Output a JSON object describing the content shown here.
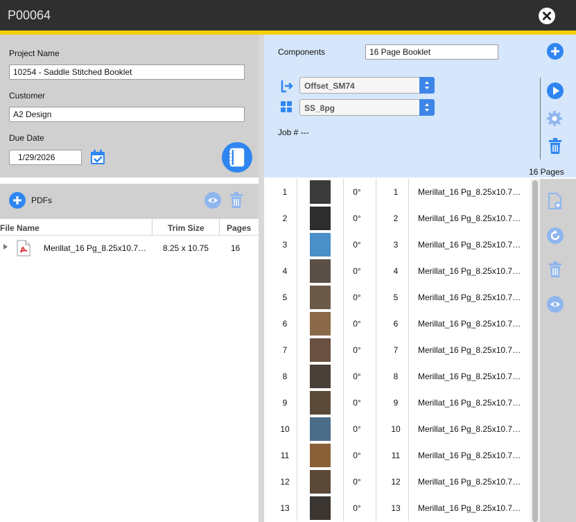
{
  "window": {
    "title": "P00064"
  },
  "project": {
    "project_name_label": "Project Name",
    "project_name": "10254 - Saddle Stitched Booklet",
    "customer_label": "Customer",
    "customer": "A2 Design",
    "due_date_label": "Due Date",
    "due_date": "1/29/2026"
  },
  "pdfs": {
    "title": "PDFs",
    "columns": [
      "File Name",
      "Trim Size",
      "Pages"
    ],
    "rows": [
      {
        "file_name": "Merillat_16 Pg_8.25x10.7…",
        "trim_size": "8.25 x 10.75",
        "pages": "16"
      }
    ]
  },
  "components": {
    "label": "Components",
    "value": "16 Page Booklet",
    "press": "Offset_SM74",
    "template": "SS_8pg",
    "job_label": "Job # ---",
    "pages_count": "16 Pages"
  },
  "page_list": {
    "rows": [
      {
        "num": "1",
        "rotation": "0°",
        "page": "1",
        "file": "Merillat_16 Pg_8.25x10.7…"
      },
      {
        "num": "2",
        "rotation": "0°",
        "page": "2",
        "file": "Merillat_16 Pg_8.25x10.7…"
      },
      {
        "num": "3",
        "rotation": "0°",
        "page": "3",
        "file": "Merillat_16 Pg_8.25x10.7…"
      },
      {
        "num": "4",
        "rotation": "0°",
        "page": "4",
        "file": "Merillat_16 Pg_8.25x10.7…"
      },
      {
        "num": "5",
        "rotation": "0°",
        "page": "5",
        "file": "Merillat_16 Pg_8.25x10.7…"
      },
      {
        "num": "6",
        "rotation": "0°",
        "page": "6",
        "file": "Merillat_16 Pg_8.25x10.7…"
      },
      {
        "num": "7",
        "rotation": "0°",
        "page": "7",
        "file": "Merillat_16 Pg_8.25x10.7…"
      },
      {
        "num": "8",
        "rotation": "0°",
        "page": "8",
        "file": "Merillat_16 Pg_8.25x10.7…"
      },
      {
        "num": "9",
        "rotation": "0°",
        "page": "9",
        "file": "Merillat_16 Pg_8.25x10.7…"
      },
      {
        "num": "10",
        "rotation": "0°",
        "page": "10",
        "file": "Merillat_16 Pg_8.25x10.7…"
      },
      {
        "num": "11",
        "rotation": "0°",
        "page": "11",
        "file": "Merillat_16 Pg_8.25x10.7…"
      },
      {
        "num": "12",
        "rotation": "0°",
        "page": "12",
        "file": "Merillat_16 Pg_8.25x10.7…"
      },
      {
        "num": "13",
        "rotation": "0°",
        "page": "13",
        "file": "Merillat_16 Pg_8.25x10.7…"
      }
    ]
  },
  "colors": {
    "accent": "#2f86f0",
    "accent_light": "#8fb6ee",
    "header": "#2f2f2f",
    "stripe": "#f4d000",
    "panel": "#d0d0d0",
    "panel_blue": "#d6e6fb"
  },
  "icons": [
    "close-icon",
    "calendar-icon",
    "booklet-icon",
    "plus-circle-icon",
    "eye-icon",
    "trash-icon",
    "pdf-file-icon",
    "press-icon",
    "grid-icon",
    "play-icon",
    "gear-icon",
    "add-page-icon",
    "rotate-icon"
  ]
}
